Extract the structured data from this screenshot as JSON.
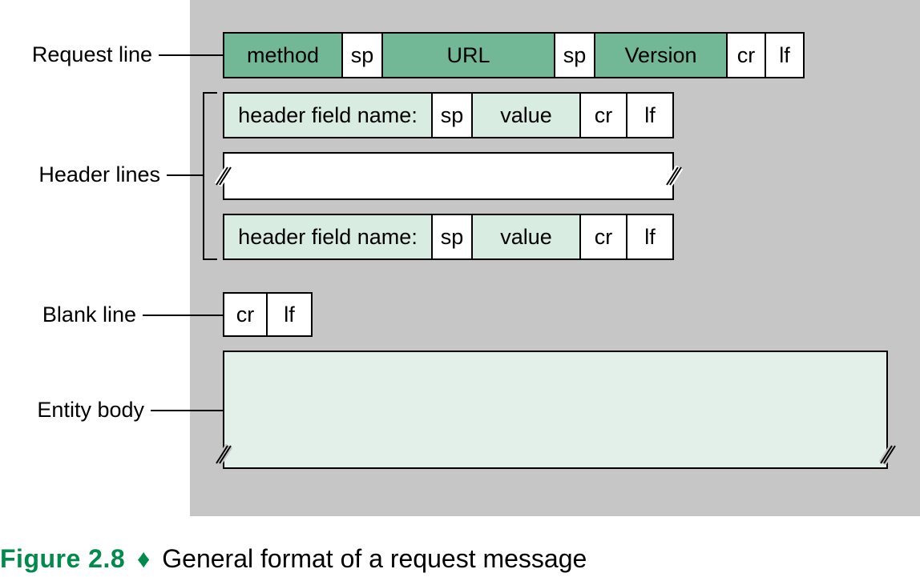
{
  "labels": {
    "request_line": "Request line",
    "header_lines": "Header lines",
    "blank_line": "Blank line",
    "entity_body": "Entity body"
  },
  "cells": {
    "method": "method",
    "sp": "sp",
    "url": "URL",
    "version": "Version",
    "cr": "cr",
    "lf": "lf",
    "hfn": "header field name:",
    "value": "value"
  },
  "caption": {
    "figure": "Figure 2.8",
    "glyph": "♦",
    "text": "General format of a request message"
  }
}
